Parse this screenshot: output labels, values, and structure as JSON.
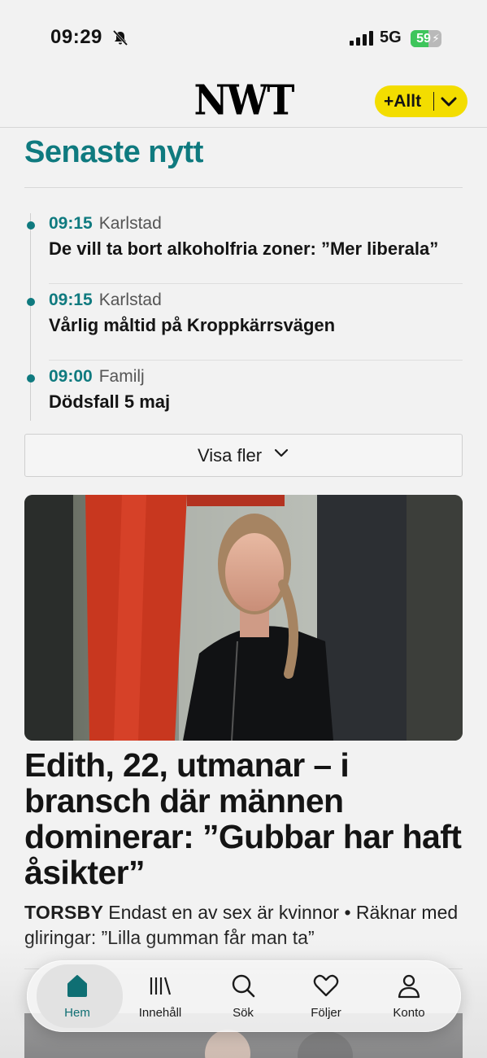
{
  "status_bar": {
    "time": "09:29",
    "network": "5G",
    "battery": "59",
    "battery_percent": 59
  },
  "header": {
    "logo": "NWT",
    "plus_button": "+Allt"
  },
  "latest": {
    "title": "Senaste nytt",
    "items": [
      {
        "time": "09:15",
        "category": "Karlstad",
        "headline": "De vill ta bort alkoholfria zoner: ”Mer liberala”"
      },
      {
        "time": "09:15",
        "category": "Karlstad",
        "headline": "Vårlig måltid på Kroppkärrsvägen"
      },
      {
        "time": "09:00",
        "category": "Familj",
        "headline": "Dödsfall 5 maj"
      }
    ],
    "more_button": "Visa fler"
  },
  "article": {
    "headline": "Edith, 22, utmanar – i bransch där männen dominerar: ”Gubbar har haft åsikter”",
    "place": "TORSBY",
    "lead": "Endast en av sex är kvinnor • Räknar med gliringar: ”Lilla gumman får man ta”"
  },
  "tabbar": {
    "tabs": [
      {
        "label": "Hem",
        "icon": "home-icon"
      },
      {
        "label": "Innehåll",
        "icon": "library-icon"
      },
      {
        "label": "Sök",
        "icon": "search-icon"
      },
      {
        "label": "Följer",
        "icon": "heart-icon"
      },
      {
        "label": "Konto",
        "icon": "person-icon"
      }
    ]
  },
  "colors": {
    "accent": "#0f7a7f",
    "plus_yellow": "#f3dd00",
    "battery_green": "#3ec55b"
  }
}
